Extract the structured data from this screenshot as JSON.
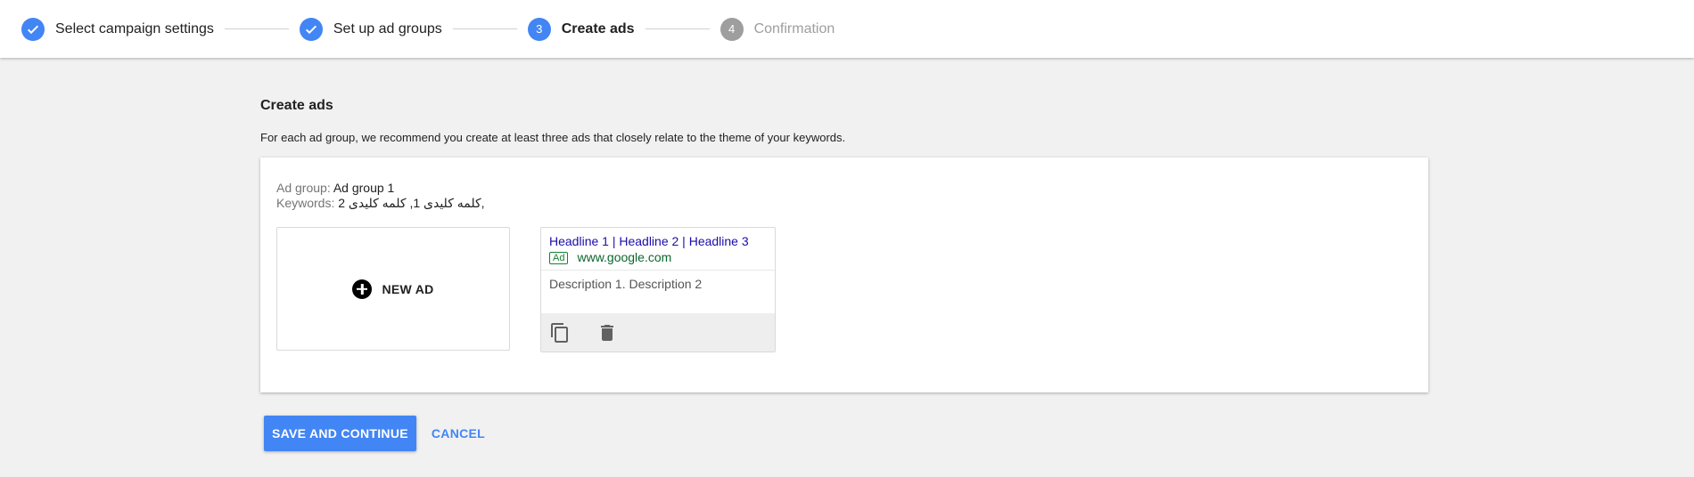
{
  "stepper": {
    "steps": [
      {
        "label": "Select campaign settings",
        "state": "done",
        "number": "1"
      },
      {
        "label": "Set up ad groups",
        "state": "done",
        "number": "2"
      },
      {
        "label": "Create ads",
        "state": "active",
        "number": "3"
      },
      {
        "label": "Confirmation",
        "state": "pending",
        "number": "4"
      }
    ]
  },
  "page": {
    "title": "Create ads",
    "description": "For each ad group, we recommend you create at least three ads that closely relate to the theme of your keywords."
  },
  "ad_group": {
    "label": "Ad group:",
    "name": "Ad group 1",
    "keywords_label": "Keywords:",
    "keywords_value": "کلمه کلیدی 1, کلمه کلیدی 2,"
  },
  "new_ad": {
    "label": "NEW AD",
    "icon": "add-circle-icon"
  },
  "ad": {
    "headline": "Headline 1 | Headline 2 | Headline 3",
    "badge": "Ad",
    "display_url": "www.google.com",
    "description": "Description 1. Description 2",
    "actions": [
      {
        "name": "copy-icon"
      },
      {
        "name": "delete-icon"
      }
    ]
  },
  "actions": {
    "save_label": "SAVE AND CONTINUE",
    "cancel_label": "CANCEL"
  },
  "colors": {
    "accent": "#4285f4",
    "pending": "#9e9e9e",
    "headline": "#1a0dab",
    "url": "#0d652d"
  }
}
